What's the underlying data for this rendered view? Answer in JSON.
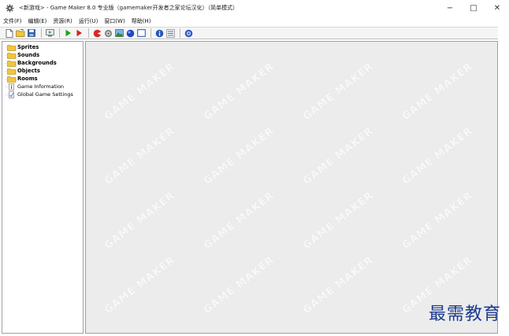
{
  "window": {
    "title": "<新游戏> - Game Maker 8.0 专业版（gamemaker开发者之家论坛汉化）（简单模式）",
    "minimize": "−",
    "maximize": "□",
    "close": "✕"
  },
  "menu": {
    "items": [
      "文件(F)",
      "编辑(E)",
      "资源(R)",
      "运行(U)",
      "窗口(W)",
      "帮助(H)"
    ]
  },
  "tree": {
    "items": [
      {
        "label": "Sprites",
        "bold": true
      },
      {
        "label": "Sounds",
        "bold": true
      },
      {
        "label": "Backgrounds",
        "bold": true
      },
      {
        "label": "Objects",
        "bold": true
      },
      {
        "label": "Rooms",
        "bold": true
      },
      {
        "label": "Game Information",
        "bold": false
      },
      {
        "label": "Global Game Settings",
        "bold": false
      }
    ]
  },
  "workspace": {
    "watermark": "GAME MAKER"
  },
  "overlay": {
    "brand": "最需教育"
  },
  "colors": {
    "folder": "#f2c53d",
    "play_green": "#1aa31a",
    "play_red": "#d62020",
    "accent_blue": "#1b3a8e"
  }
}
